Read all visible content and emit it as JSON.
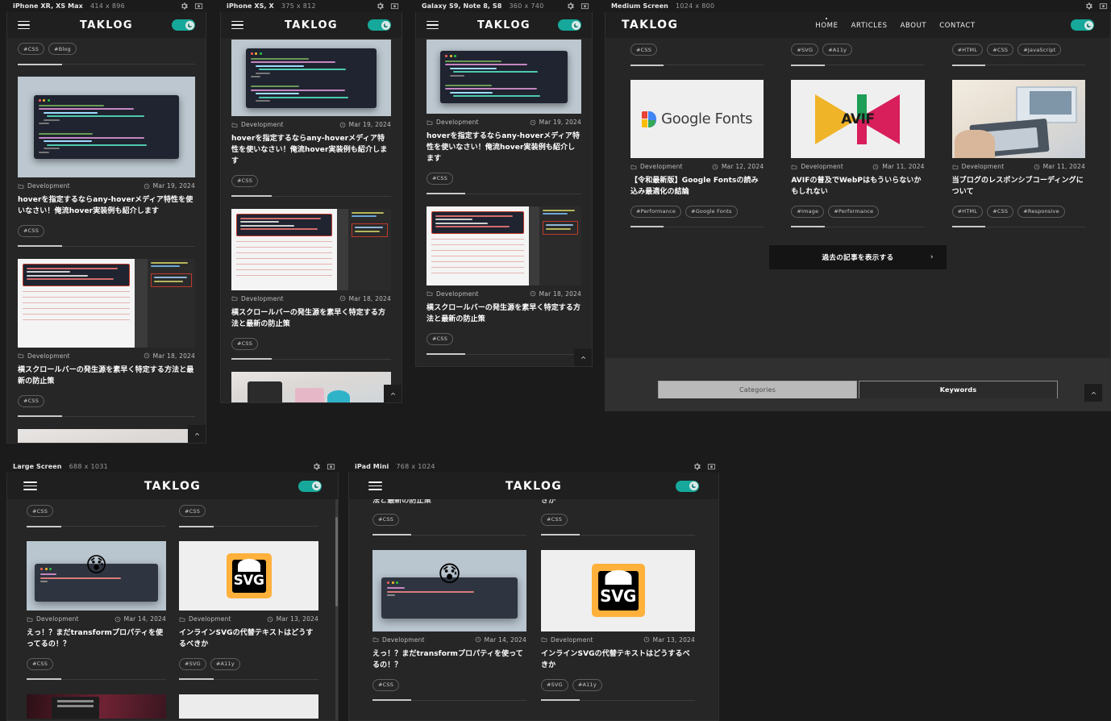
{
  "app": {
    "background": "#1b1b1b",
    "accent": "#16a89a"
  },
  "devices": [
    {
      "name": "iPhone XR, XS Max",
      "size": "414 x 896"
    },
    {
      "name": "iPhone XS, X",
      "size": "375 x 812"
    },
    {
      "name": "Galaxy S9, Note 8, S8",
      "size": "360 x 740"
    },
    {
      "name": "Medium Screen",
      "size": "1024 x 800"
    },
    {
      "name": "Large Screen",
      "size": "688 x 1031"
    },
    {
      "name": "iPad Mini",
      "size": "768 x 1024"
    }
  ],
  "icons": {
    "settings": "gear-icon",
    "screenshot": "camera-icon",
    "menu": "hamburger-icon",
    "theme": "moon-icon",
    "category": "folder-icon",
    "date": "clock-icon",
    "scroll_top": "chevron-up-icon",
    "next": "chevron-right-icon"
  },
  "site": {
    "brand": "TAKLOG",
    "nav": [
      {
        "label": "HOME",
        "active": true
      },
      {
        "label": "ARTICLES",
        "active": false
      },
      {
        "label": "ABOUT",
        "active": false
      },
      {
        "label": "CONTACT",
        "active": false
      }
    ],
    "load_more": "過去の記事を表示する",
    "load_more_chevron": "›",
    "footer_tabs": [
      {
        "label": "Categories",
        "active": false
      },
      {
        "label": "Keywords",
        "active": true
      }
    ]
  },
  "articles": {
    "hover": {
      "category": "Development",
      "date": "Mar 19, 2024",
      "title": "hoverを指定するならany-hoverメディア特性を使いなさい！俺流hover実装例も紹介します",
      "title_galaxy": "hoverを指定するならany-hoverメディア特性を使いなさい！俺流hover実装例も紹介します",
      "tags": [
        "#CSS"
      ]
    },
    "scrollbar": {
      "category": "Development",
      "date": "Mar 18, 2024",
      "title": "横スクロールバーの発生源を素早く特定する方法と最新の防止策",
      "tags": [
        "#CSS"
      ]
    },
    "googlefonts": {
      "category": "Development",
      "date": "Mar 12, 2024",
      "title": "【令和最新版】Google Fontsの読み込み最適化の結論",
      "tags": [
        "#Performance",
        "#Google Fonts"
      ],
      "logo_text": "Google Fonts"
    },
    "avif": {
      "category": "Development",
      "date": "Mar 11, 2024",
      "title": "AVIFの普及でWebPはもういらないかもしれない",
      "tags": [
        "#Image",
        "#Performance"
      ],
      "logo_text": "AVIF"
    },
    "responsive": {
      "category": "Development",
      "date": "Mar 11, 2024",
      "title": "当ブログのレスポンシブコーディングについて",
      "tags": [
        "#HTML",
        "#CSS",
        "#Responsive"
      ]
    },
    "transform": {
      "category": "Development",
      "date": "Mar 14, 2024",
      "title": "えっ！？まだtransformプロパティを使ってるの！？",
      "tags": [
        "#CSS"
      ],
      "emoji": "😰"
    },
    "svgalt": {
      "category": "Development",
      "date": "Mar 13, 2024",
      "title": "インラインSVGの代替テキストはどうするべきか",
      "tags": [
        "#SVG",
        "#A11y"
      ],
      "logo_text": "SVG"
    },
    "cut_top": {
      "tags_a": [
        "#CSS",
        "#Blog"
      ],
      "tags_b": [
        "#CSS"
      ],
      "tags_c": [
        "#SVG",
        "#A11y"
      ],
      "tags_d": [
        "#HTML",
        "#CSS",
        "#JavaScript"
      ],
      "partial_title_left": "法と最新の防止策",
      "partial_title_right": "きか"
    }
  }
}
